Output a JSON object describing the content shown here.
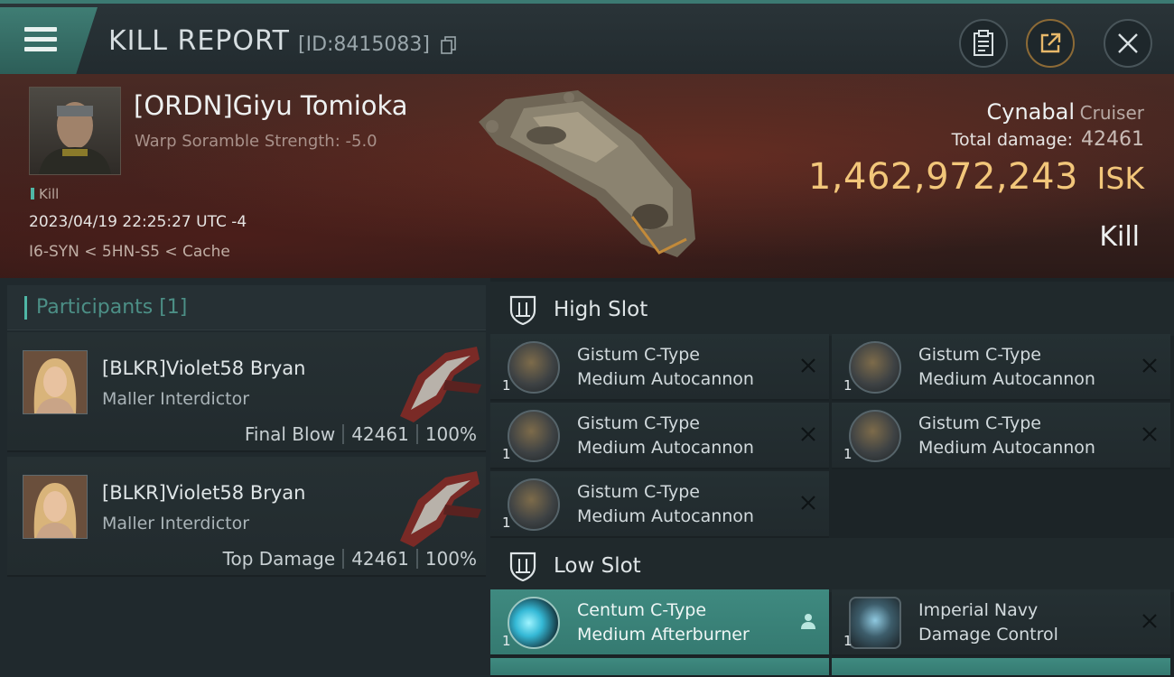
{
  "header": {
    "title": "KILL REPORT",
    "report_id": "[ID:8415083]"
  },
  "victim": {
    "name": "[ORDN]Giyu Tomioka",
    "scramble": "Warp Soramble Strength: -5.0",
    "tag": "Kill",
    "datetime": "2023/04/19 22:25:27 UTC -4",
    "location": "I6-SYN < 5HN-S5 < Cache"
  },
  "ship": {
    "name": "Cynabal",
    "class": "Cruiser",
    "damage_label": "Total damage:",
    "damage_value": "42461",
    "isk_value": "1,462,972,243",
    "isk_unit": "ISK",
    "result": "Kill"
  },
  "participants": {
    "label": "Participants [1]",
    "items": [
      {
        "name": "[BLKR]Violet58 Bryan",
        "ship": "Maller Interdictor",
        "role": "Final Blow",
        "damage": "42461",
        "percent": "100%"
      },
      {
        "name": "[BLKR]Violet58 Bryan",
        "ship": "Maller Interdictor",
        "role": "Top Damage",
        "damage": "42461",
        "percent": "100%"
      }
    ]
  },
  "slots": {
    "high": {
      "label": "High Slot",
      "modules": [
        {
          "line1": "Gistum C-Type",
          "line2": "Medium Autocannon",
          "qty": "1",
          "status": "destroyed"
        },
        {
          "line1": "Gistum C-Type",
          "line2": "Medium Autocannon",
          "qty": "1",
          "status": "destroyed"
        },
        {
          "line1": "Gistum C-Type",
          "line2": "Medium Autocannon",
          "qty": "1",
          "status": "destroyed"
        },
        {
          "line1": "Gistum C-Type",
          "line2": "Medium Autocannon",
          "qty": "1",
          "status": "destroyed"
        },
        {
          "line1": "Gistum C-Type",
          "line2": "Medium Autocannon",
          "qty": "1",
          "status": "destroyed"
        }
      ]
    },
    "low": {
      "label": "Low Slot",
      "modules": [
        {
          "line1": "Centum C-Type",
          "line2": "Medium Afterburner",
          "qty": "1",
          "status": "dropped"
        },
        {
          "line1": "Imperial Navy",
          "line2": "Damage Control",
          "qty": "1",
          "status": "destroyed"
        }
      ]
    }
  },
  "icons": [
    "menu-icon",
    "copy-icon",
    "clipboard-icon",
    "external-link-icon",
    "close-icon",
    "shield-icon",
    "destroyed-x-icon",
    "pilot-icon"
  ],
  "colors": {
    "accent": "#4fb7a6",
    "isk": "#f2c67a",
    "highlight": "#3f8a80"
  }
}
